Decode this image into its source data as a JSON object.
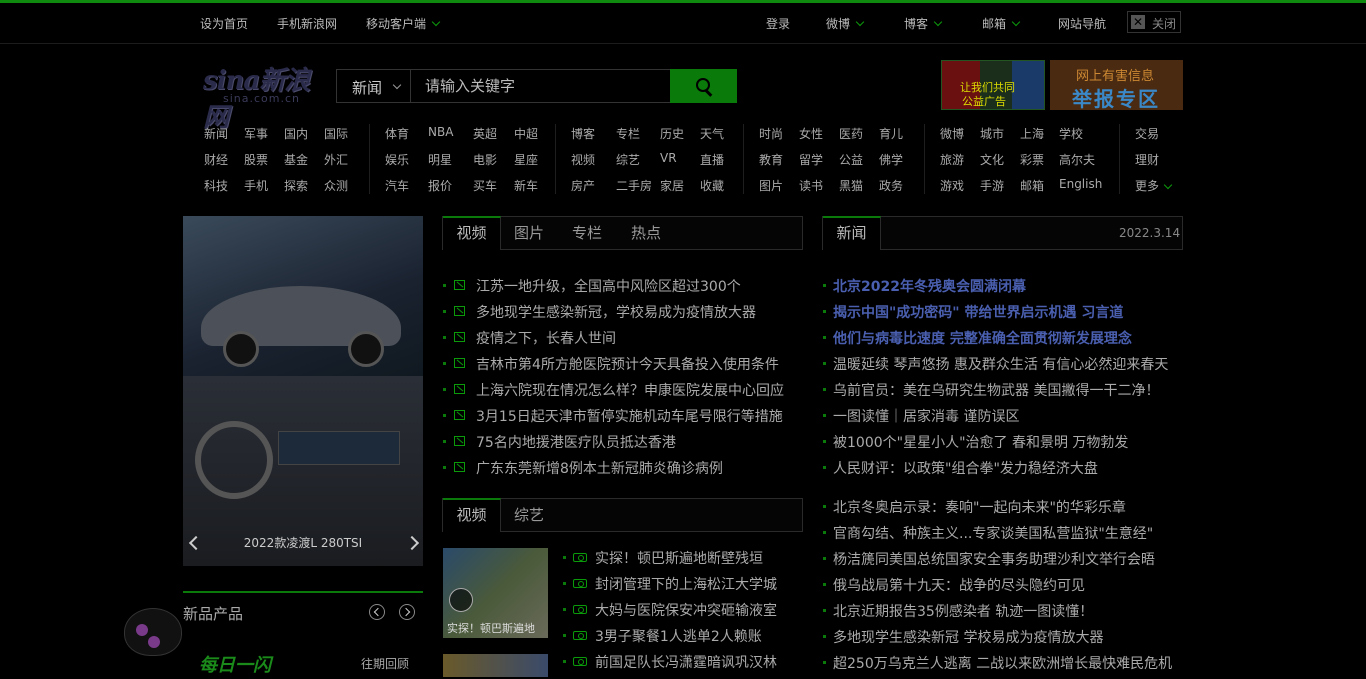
{
  "topbar": {
    "left": [
      "设为首页",
      "手机新浪网",
      "移动客户端"
    ],
    "login": "登录",
    "weibo": "微博",
    "blog": "博客",
    "mail": "邮箱",
    "site_nav": "网站导航",
    "close": "关闭"
  },
  "logo": {
    "main": "sina新浪网",
    "sub": "sina.com.cn"
  },
  "search": {
    "category": "新闻",
    "placeholder": "请输入关键字"
  },
  "ads": {
    "ad1_line1": "让我们共同",
    "ad1_line2": "公益广告",
    "ad2_line1": "网上有害信息",
    "ad2_line2": "举报专区"
  },
  "nav": {
    "g1": [
      [
        "新闻",
        "军事",
        "国内",
        "国际"
      ],
      [
        "财经",
        "股票",
        "基金",
        "外汇"
      ],
      [
        "科技",
        "手机",
        "探索",
        "众测"
      ]
    ],
    "g2": [
      [
        "体育",
        "NBA",
        "英超",
        "中超"
      ],
      [
        "娱乐",
        "明星",
        "电影",
        "星座"
      ],
      [
        "汽车",
        "报价",
        "买车",
        "新车"
      ]
    ],
    "g3": [
      [
        "博客",
        "专栏",
        "历史",
        "天气"
      ],
      [
        "视频",
        "综艺",
        "VR",
        "直播"
      ],
      [
        "房产",
        "二手房",
        "家居",
        "收藏"
      ]
    ],
    "g4": [
      [
        "时尚",
        "女性",
        "医药",
        "育儿"
      ],
      [
        "教育",
        "留学",
        "公益",
        "佛学"
      ],
      [
        "图片",
        "读书",
        "黑猫",
        "政务"
      ]
    ],
    "g5": [
      [
        "微博",
        "城市",
        "上海",
        "学校"
      ],
      [
        "旅游",
        "文化",
        "彩票",
        "高尔夫"
      ],
      [
        "游戏",
        "手游",
        "邮箱",
        "English"
      ]
    ],
    "g6": [
      "交易",
      "理财",
      "更多"
    ]
  },
  "focus": {
    "caption": "2022款凌渡L 280TSI"
  },
  "new_products": {
    "title": "新品产品",
    "daily": "每日一闪",
    "past": "往期回顾"
  },
  "tabs1": [
    "视频",
    "图片",
    "专栏",
    "热点"
  ],
  "list1": [
    "江苏一地升级，全国高中风险区超过300个",
    "多地现学生感染新冠，学校易成为疫情放大器",
    "疫情之下，长春人世间",
    "吉林市第4所方舱医院预计今天具备投入使用条件",
    "上海六院现在情况怎么样？申康医院发展中心回应",
    "3月15日起天津市暂停实施机动车尾号限行等措施",
    "75名内地援港医疗队员抵达香港",
    "广东东莞新增8例本土新冠肺炎确诊病例"
  ],
  "tabs2": [
    "视频",
    "综艺"
  ],
  "video_list": [
    "实探！顿巴斯遍地断壁残垣",
    "封闭管理下的上海松江大学城",
    "大妈与医院保安冲突砸输液室",
    "3男子聚餐1人逃单2人赖账",
    "前国足队长冯潇霆暗讽巩汉林"
  ],
  "video_thumb_caption": "实探！顿巴斯遍地",
  "news": {
    "tab": "新闻",
    "date": "2022.3.14",
    "headlines": [
      "北京2022年冬残奥会圆满闭幕",
      "揭示中国\"成功密码\" 带给世界启示机遇 习言道",
      "他们与病毒比速度 完整准确全面贯彻新发展理念"
    ],
    "items": [
      "温暖延续 琴声悠扬 惠及群众生活 有信心必然迎来春天",
      "乌前官员：美在乌研究生物武器 美国撇得一干二净！",
      "一图读懂｜居家消毒 谨防误区",
      "被1000个\"星星小人\"治愈了 春和景明 万物勃发",
      "人民财评：以政策\"组合拳\"发力稳经济大盘"
    ],
    "items2": [
      "北京冬奥启示录：奏响\"一起向未来\"的华彩乐章",
      "官商勾结、种族主义...专家谈美国私营监狱\"生意经\"",
      "杨洁篪同美国总统国家安全事务助理沙利文举行会晤",
      "俄乌战局第十九天：战争的尽头隐约可见",
      "北京近期报告35例感染者 轨迹一图读懂！",
      "多地现学生感染新冠 学校易成为疫情放大器",
      "超250万乌克兰人逃离 二战以来欧洲增长最快难民危机"
    ]
  }
}
